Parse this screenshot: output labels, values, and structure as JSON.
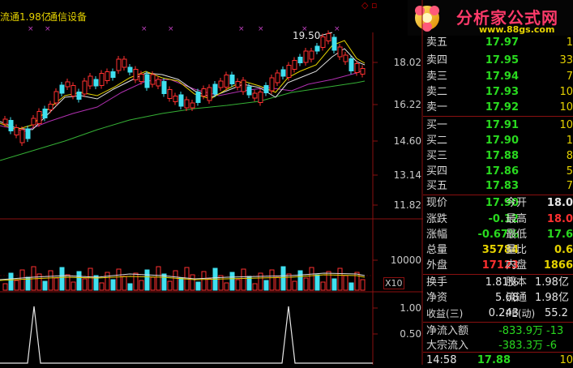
{
  "header": {
    "float_label": "流通1.98亿",
    "sector_label": "通信设备"
  },
  "chart": {
    "high_marker": "19.50",
    "price_axis": [
      "18.02",
      "16.22",
      "14.60",
      "13.14",
      "11.82"
    ],
    "volume_axis": "10000",
    "volume_unit": "X10",
    "indicator_axis": [
      "1.00",
      "0.50"
    ]
  },
  "logo": {
    "title": "分析家公式网",
    "url": "www.88gs.com"
  },
  "order_book": {
    "asks": [
      {
        "label": "卖五",
        "price": "17.97",
        "volume": "1"
      },
      {
        "label": "卖四",
        "price": "17.95",
        "volume": "33"
      },
      {
        "label": "卖三",
        "price": "17.94",
        "volume": "7"
      },
      {
        "label": "卖二",
        "price": "17.93",
        "volume": "10"
      },
      {
        "label": "卖一",
        "price": "17.92",
        "volume": "10"
      }
    ],
    "bids": [
      {
        "label": "买一",
        "price": "17.91",
        "volume": "10"
      },
      {
        "label": "买二",
        "price": "17.90",
        "volume": "1"
      },
      {
        "label": "买三",
        "price": "17.88",
        "volume": "8"
      },
      {
        "label": "买四",
        "price": "17.86",
        "volume": "5"
      },
      {
        "label": "买五",
        "price": "17.83",
        "volume": "7"
      }
    ]
  },
  "quote": {
    "rows": [
      {
        "l1": "现价",
        "v1": "17.90",
        "c1": "green",
        "l2": "今开",
        "v2": "18.0",
        "c2": "white"
      },
      {
        "l1": "涨跌",
        "v1": "-0.12",
        "c1": "green",
        "l2": "最高",
        "v2": "18.0",
        "c2": "red"
      },
      {
        "l1": "涨幅",
        "v1": "-0.67%",
        "c1": "green",
        "l2": "最低",
        "v2": "17.6",
        "c2": "green"
      },
      {
        "l1": "总量",
        "v1": "35784",
        "c1": "yellow",
        "l2": "量比",
        "v2": "0.6",
        "c2": "yellow"
      },
      {
        "l1": "外盘",
        "v1": "17123",
        "c1": "red",
        "l2": "内盘",
        "v2": "1866",
        "c2": "yellow"
      }
    ],
    "rows2": [
      {
        "l1": "换手",
        "v1": "1.81%",
        "l2": "股本",
        "v2": "1.98亿"
      },
      {
        "l1": "净资",
        "v1": "5.68",
        "l2": "流通",
        "v2": "1.98亿"
      },
      {
        "l1": "收益(三)",
        "v1": "0.243",
        "l2": "PE(动)",
        "v2": "55.2"
      }
    ],
    "flows": [
      {
        "label": "净流入额",
        "v1": "-833.9万",
        "v2": "-13"
      },
      {
        "label": "大宗流入",
        "v1": "-383.3万",
        "v2": "-6"
      }
    ],
    "tick": {
      "time": "14:58",
      "price": "17.88",
      "volume": "10"
    }
  }
}
